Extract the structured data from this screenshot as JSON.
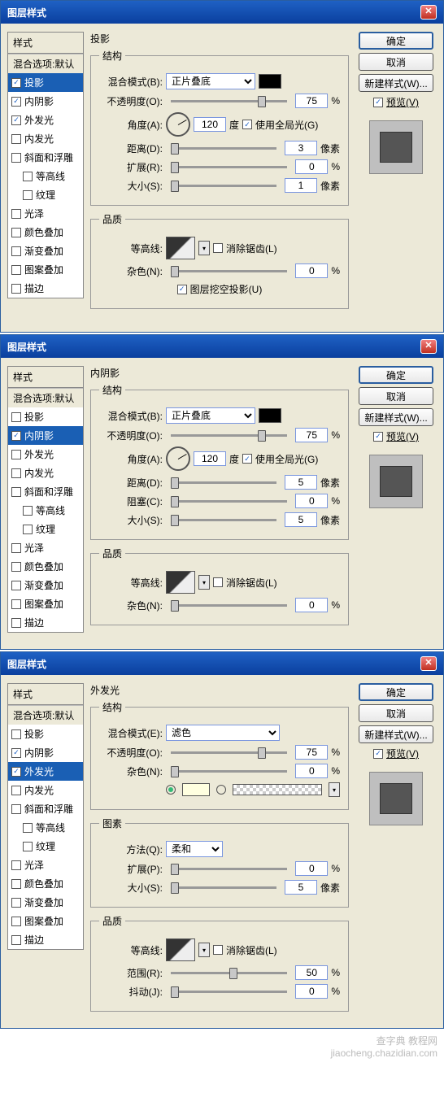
{
  "dialogs": [
    {
      "title": "图层样式",
      "effect_title": "投影",
      "styles": {
        "header": "样式",
        "blend_options": "混合选项:默认",
        "items": [
          {
            "label": "投影",
            "checked": true,
            "selected": true
          },
          {
            "label": "内阴影",
            "checked": true
          },
          {
            "label": "外发光",
            "checked": true
          },
          {
            "label": "内发光"
          },
          {
            "label": "斜面和浮雕"
          },
          {
            "label": "等高线",
            "indent": true
          },
          {
            "label": "纹理",
            "indent": true
          },
          {
            "label": "光泽"
          },
          {
            "label": "颜色叠加"
          },
          {
            "label": "渐变叠加"
          },
          {
            "label": "图案叠加"
          },
          {
            "label": "描边"
          }
        ]
      },
      "structure": {
        "legend": "结构",
        "blend_mode_label": "混合模式(B):",
        "blend_mode_value": "正片叠底",
        "opacity_label": "不透明度(O):",
        "opacity_value": "75",
        "angle_label": "角度(A):",
        "angle_value": "120",
        "angle_unit": "度",
        "global_light": "使用全局光(G)",
        "distance_label": "距离(D):",
        "distance_value": "3",
        "distance_unit": "像素",
        "spread_label": "扩展(R):",
        "spread_value": "0",
        "size_label": "大小(S):",
        "size_value": "1",
        "size_unit": "像素"
      },
      "quality": {
        "legend": "品质",
        "contour_label": "等高线:",
        "antialias": "消除锯齿(L)",
        "noise_label": "杂色(N):",
        "noise_value": "0"
      },
      "knockout": "图层挖空投影(U)",
      "buttons": {
        "ok": "确定",
        "cancel": "取消",
        "new_style": "新建样式(W)...",
        "preview": "预览(V)"
      }
    },
    {
      "title": "图层样式",
      "effect_title": "内阴影",
      "styles": {
        "header": "样式",
        "blend_options": "混合选项:默认",
        "items": [
          {
            "label": "投影"
          },
          {
            "label": "内阴影",
            "checked": true,
            "selected": true
          },
          {
            "label": "外发光"
          },
          {
            "label": "内发光"
          },
          {
            "label": "斜面和浮雕"
          },
          {
            "label": "等高线",
            "indent": true
          },
          {
            "label": "纹理",
            "indent": true
          },
          {
            "label": "光泽"
          },
          {
            "label": "颜色叠加"
          },
          {
            "label": "渐变叠加"
          },
          {
            "label": "图案叠加"
          },
          {
            "label": "描边"
          }
        ]
      },
      "structure": {
        "legend": "结构",
        "blend_mode_label": "混合模式(B):",
        "blend_mode_value": "正片叠底",
        "opacity_label": "不透明度(O):",
        "opacity_value": "75",
        "angle_label": "角度(A):",
        "angle_value": "120",
        "angle_unit": "度",
        "global_light": "使用全局光(G)",
        "distance_label": "距离(D):",
        "distance_value": "5",
        "distance_unit": "像素",
        "spread_label": "阻塞(C):",
        "spread_value": "0",
        "size_label": "大小(S):",
        "size_value": "5",
        "size_unit": "像素"
      },
      "quality": {
        "legend": "品质",
        "contour_label": "等高线:",
        "antialias": "消除锯齿(L)",
        "noise_label": "杂色(N):",
        "noise_value": "0"
      },
      "buttons": {
        "ok": "确定",
        "cancel": "取消",
        "new_style": "新建样式(W)...",
        "preview": "预览(V)"
      }
    },
    {
      "title": "图层样式",
      "effect_title": "外发光",
      "styles": {
        "header": "样式",
        "blend_options": "混合选项:默认",
        "items": [
          {
            "label": "投影"
          },
          {
            "label": "内阴影",
            "checked": true
          },
          {
            "label": "外发光",
            "checked": true,
            "selected": true
          },
          {
            "label": "内发光"
          },
          {
            "label": "斜面和浮雕"
          },
          {
            "label": "等高线",
            "indent": true
          },
          {
            "label": "纹理",
            "indent": true
          },
          {
            "label": "光泽"
          },
          {
            "label": "颜色叠加"
          },
          {
            "label": "渐变叠加"
          },
          {
            "label": "图案叠加"
          },
          {
            "label": "描边"
          }
        ]
      },
      "structure": {
        "legend": "结构",
        "blend_mode_label": "混合模式(E):",
        "blend_mode_value": "滤色",
        "opacity_label": "不透明度(O):",
        "opacity_value": "75",
        "noise_label": "杂色(N):",
        "noise_value": "0"
      },
      "elements": {
        "legend": "图素",
        "tech_label": "方法(Q):",
        "tech_value": "柔和",
        "spread_label": "扩展(P):",
        "spread_value": "0",
        "size_label": "大小(S):",
        "size_value": "5",
        "size_unit": "像素"
      },
      "quality": {
        "legend": "品质",
        "contour_label": "等高线:",
        "antialias": "消除锯齿(L)",
        "range_label": "范围(R):",
        "range_value": "50",
        "jitter_label": "抖动(J):",
        "jitter_value": "0"
      },
      "buttons": {
        "ok": "确定",
        "cancel": "取消",
        "new_style": "新建样式(W)...",
        "preview": "预览(V)"
      }
    }
  ],
  "percent": "%",
  "watermark_cn": "查字典 教程网",
  "watermark_url": "jiaocheng.chazidian.com"
}
